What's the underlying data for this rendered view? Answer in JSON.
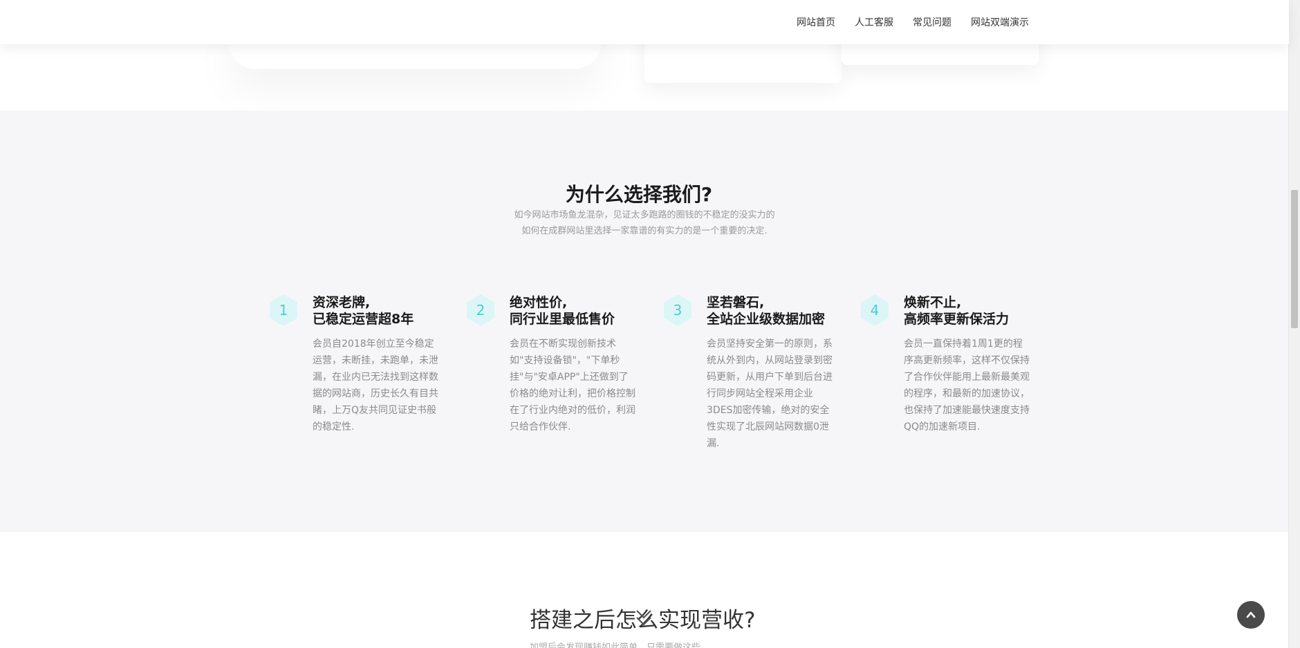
{
  "nav": {
    "items": [
      {
        "label": "网站首页"
      },
      {
        "label": "人工客服"
      },
      {
        "label": "常见问题"
      },
      {
        "label": "网站双端演示"
      }
    ]
  },
  "why": {
    "title": "为什么选择我们?",
    "subtitle_line1": "如今网站市场鱼龙混杂，见证太多跑路的圈钱的不稳定的没实力的",
    "subtitle_line2": "如何在成群网站里选择一家靠谱的有实力的是一个重要的决定.",
    "features": [
      {
        "number": "1",
        "title_line1": "资深老牌,",
        "title_line2": "已稳定运营超8年",
        "desc": "会员自2018年创立至今稳定运营，未断挂，未跑单，未泄漏，在业内已无法找到这样数据的网站商，历史长久有目共睹，上万Q友共同见证史书般的稳定性."
      },
      {
        "number": "2",
        "title_line1": "绝对性价,",
        "title_line2": "同行业里最低售价",
        "desc": "会员在不断实现创新技术如\"支持设备锁\"，\"下单秒挂\"与\"安卓APP\"上还做到了价格的绝对让利，把价格控制在了行业内绝对的低价，利润只给合作伙伴."
      },
      {
        "number": "3",
        "title_line1": "坚若磐石,",
        "title_line2": "全站企业级数据加密",
        "desc": "会员坚持安全第一的原则，系统从外到内，从网站登录到密码更新，从用户下单到后台进行同步网站全程采用企业3DES加密传输，绝对的安全性实现了北辰网站网数据0泄漏."
      },
      {
        "number": "4",
        "title_line1": "焕新不止,",
        "title_line2": "高频率更新保活力",
        "desc": "会员一直保持着1周1更的程序高更新频率，这样不仅保持了合作伙伴能用上最新最美观的程序，和最新的加速协议，也保持了加速能最快速度支持QQ的加速新项目."
      }
    ]
  },
  "bottom": {
    "title": "搭建之后怎么实现营收?",
    "subtitle": "加盟后会发现赚钱如此简单，只需要做这些"
  },
  "icons": {
    "back_to_top": "chevron-up-icon",
    "decor": "double-chevron-down-icon"
  },
  "colors": {
    "accent": "#4ccdd2",
    "hex_bg": "#dcf6f7",
    "section_bg": "#f6f6f8"
  }
}
